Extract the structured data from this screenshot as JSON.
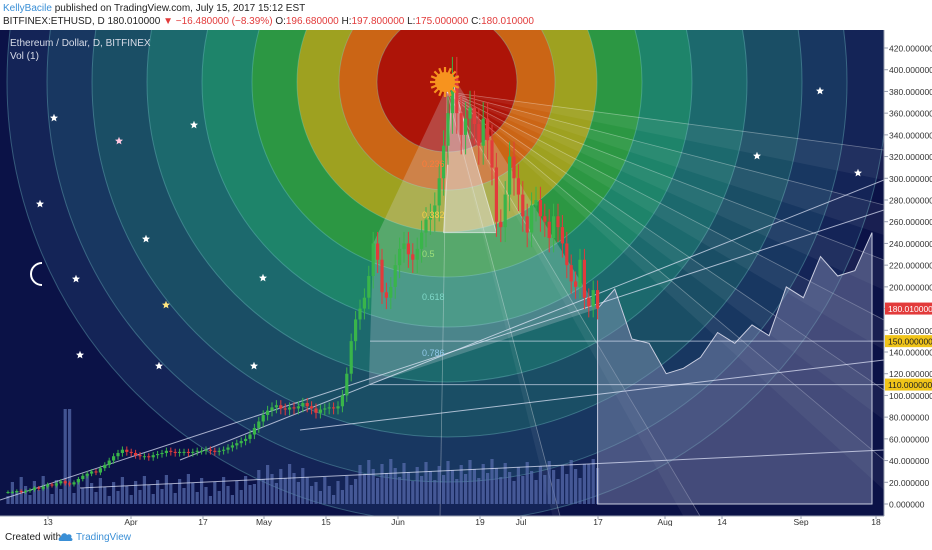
{
  "header": {
    "author": "KellyBacile",
    "published": "published on TradingView.com, July 15, 2017 15:12 EST",
    "symbol": "BITFINEX:ETHUSD, D",
    "last": "180.010000",
    "change": "−16.480000 (−8.39%)",
    "o_label": "O:",
    "o_value": "196.680000",
    "h_label": "H:",
    "h_value": "197.800000",
    "l_label": "L:",
    "l_value": "175.000000",
    "c_label": "C:",
    "c_value": "180.010000"
  },
  "legend": {
    "title": "Ethereum / Dollar, D, BITFINEX",
    "volume": "Vol (1)"
  },
  "fib_labels": [
    "0.236",
    "0.382",
    "0.5",
    "0.618",
    "0.786"
  ],
  "price_tags": [
    {
      "value": 180.01,
      "text": "180.010000",
      "color": "#e23b3b",
      "text_color": "#ffffff"
    },
    {
      "value": 150.0,
      "text": "150.000000",
      "color": "#f0c419",
      "text_color": "#222222"
    },
    {
      "value": 110.0,
      "text": "110.000000",
      "color": "#f0c419",
      "text_color": "#222222"
    }
  ],
  "footer": {
    "created": "Created with",
    "brand": "TradingView"
  },
  "colors": {
    "background": "#0b1247",
    "up": "#39b54a",
    "down": "#e23b3b",
    "sun": "#f7931e",
    "moon": "#ffffff",
    "fib_rings": [
      "#b00000",
      "#d94e1c",
      "#d9a01c",
      "#1c9a3c",
      "#19776e",
      "#175566",
      "#1a4060"
    ]
  },
  "icons": [
    "sun-icon",
    "moon-icon",
    "star-icon",
    "tradingview-logo-icon"
  ],
  "chart_data": {
    "type": "candlestick",
    "title": "Ethereum / Dollar, D, BITFINEX",
    "ylim": [
      0,
      420
    ],
    "y_ticks": [
      0,
      20,
      40,
      60,
      80,
      100,
      120,
      140,
      160,
      180,
      200,
      220,
      240,
      260,
      280,
      300,
      320,
      340,
      360,
      380,
      400,
      420
    ],
    "y_tick_labels": [
      "0.000000",
      "20.000000",
      "40.000000",
      "60.000000",
      "80.000000",
      "100.000000",
      "120.000000",
      "140.000000",
      "160.000000",
      "180.000000",
      "200.000000",
      "220.000000",
      "240.000000",
      "260.000000",
      "280.000000",
      "300.000000",
      "320.000000",
      "340.000000",
      "360.000000",
      "380.000000",
      "400.000000",
      "420.000000"
    ],
    "x_ticks": [
      "13",
      "Apr",
      "17",
      "May",
      "15",
      "Jun",
      "19",
      "Jul",
      "17",
      "Aug",
      "14",
      "Sep",
      "18"
    ],
    "grid": false,
    "series": [
      {
        "kind": "ohlc",
        "close": [
          11,
          11,
          12,
          11,
          12,
          13,
          15,
          14,
          16,
          18,
          17,
          19,
          21,
          19,
          18,
          20,
          23,
          26,
          28,
          30,
          29,
          33,
          36,
          40,
          44,
          47,
          50,
          48,
          47,
          45,
          44,
          44,
          43,
          45,
          46,
          47,
          49,
          48,
          47,
          48,
          48,
          47,
          48,
          49,
          49,
          50,
          49,
          48,
          49,
          50,
          52,
          54,
          56,
          58,
          60,
          64,
          70,
          76,
          82,
          86,
          89,
          91,
          88,
          87,
          89,
          88,
          90,
          93,
          90,
          88,
          84,
          87,
          88,
          89,
          88,
          90,
          100,
          120,
          150,
          170,
          180,
          190,
          210,
          240,
          225,
          195,
          190,
          200,
          220,
          235,
          240,
          230,
          225,
          235,
          250,
          262,
          265,
          275,
          300,
          330,
          360,
          395,
          360,
          340,
          355,
          365,
          350,
          330,
          355,
          335,
          310,
          260,
          255,
          285,
          320,
          300,
          285,
          265,
          250,
          275,
          280,
          265,
          260,
          245,
          265,
          255,
          240,
          220,
          205,
          200,
          225,
          190,
          182,
          197,
          180
        ]
      },
      {
        "kind": "projection",
        "values": [
          180,
          198,
          152,
          148,
          120,
          125,
          135,
          158,
          148,
          165,
          155,
          200,
          190,
          228,
          210,
          215,
          250
        ]
      }
    ]
  }
}
